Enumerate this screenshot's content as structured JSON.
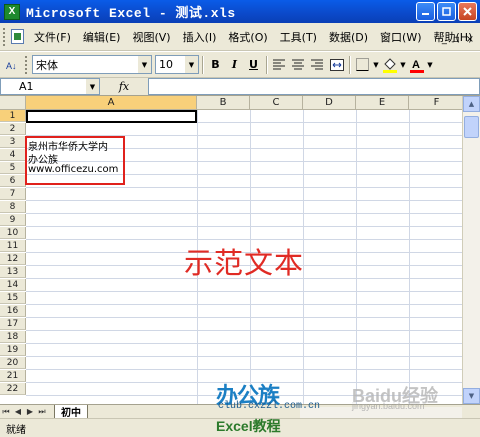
{
  "window": {
    "title": "Microsoft Excel - 测试.xls"
  },
  "menu": {
    "items": [
      "文件(F)",
      "编辑(E)",
      "视图(V)",
      "插入(I)",
      "格式(O)",
      "工具(T)",
      "数据(D)",
      "窗口(W)",
      "帮助(H)"
    ],
    "mdi_controls": [
      "_",
      "♬",
      "×"
    ]
  },
  "toolbar": {
    "font_name": "宋体",
    "font_size": "10",
    "bold": "B",
    "italic": "I",
    "underline": "U",
    "fill_color": "#ffff00",
    "font_color": "#ff0000"
  },
  "formula_bar": {
    "name_box": "A1",
    "fx": "fx",
    "value": ""
  },
  "grid": {
    "columns": [
      "A",
      "B",
      "C",
      "D",
      "E",
      "F"
    ],
    "active_column": "A",
    "rows": [
      "1",
      "2",
      "3",
      "4",
      "5",
      "6",
      "7",
      "8",
      "9",
      "10",
      "11",
      "12",
      "13",
      "14",
      "15",
      "16",
      "17",
      "18",
      "19",
      "20",
      "21",
      "22"
    ],
    "active_row": "1",
    "cells": [
      {
        "ref": "A3",
        "text": "泉州市华侨大学内"
      },
      {
        "ref": "A4",
        "text": "办公族"
      },
      {
        "ref": "A5",
        "text": "www.officezu.com"
      }
    ],
    "sample_text": "示范文本"
  },
  "sheets": {
    "tabs": [
      "初中"
    ],
    "active": "初中",
    "nav": [
      "⏮",
      "◀",
      "▶",
      "⏭"
    ]
  },
  "status": {
    "text": "就绪"
  },
  "watermarks": {
    "site": "办公族",
    "url": "club.cxzzl.com.cn",
    "excel": "Excel教程",
    "baidu": "Baidu经验",
    "jingyan": "jingyan.baidu.com"
  },
  "colors": {
    "titlebar": "#0b49c9",
    "highlight_box": "#e0211c",
    "sample_text": "#e02b25"
  }
}
